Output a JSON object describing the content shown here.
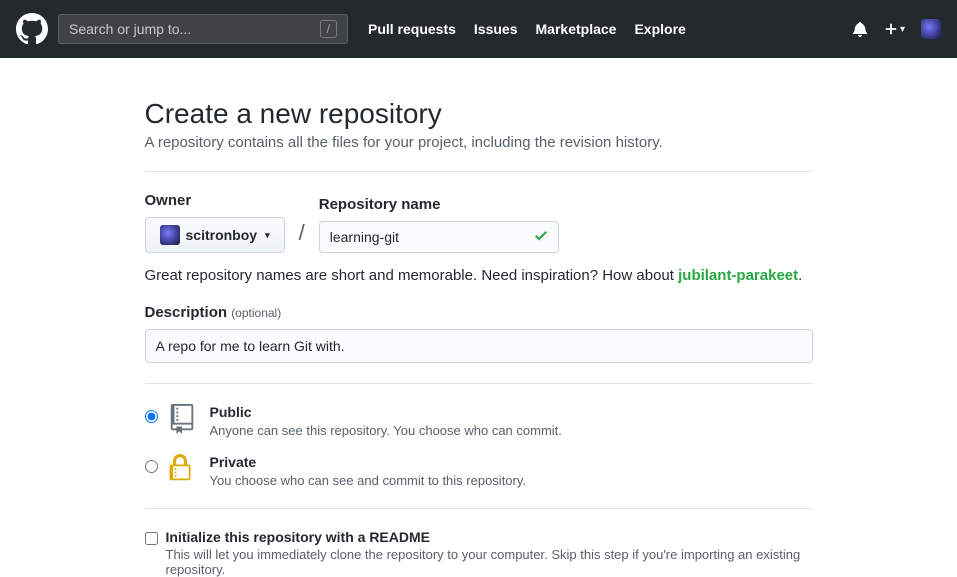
{
  "header": {
    "search_placeholder": "Search or jump to...",
    "slash_key": "/",
    "nav": {
      "pull_requests": "Pull requests",
      "issues": "Issues",
      "marketplace": "Marketplace",
      "explore": "Explore"
    }
  },
  "page": {
    "title": "Create a new repository",
    "subtitle": "A repository contains all the files for your project, including the revision history."
  },
  "form": {
    "owner_label": "Owner",
    "owner_value": "scitronboy",
    "slash": "/",
    "repo_label": "Repository name",
    "repo_value": "learning-git",
    "hint_prefix": "Great repository names are short and memorable. Need inspiration? How about ",
    "hint_suggestion": "jubilant-parakeet",
    "hint_suffix": ".",
    "desc_label": "Description",
    "desc_optional": "(optional)",
    "desc_value": "A repo for me to learn Git with.",
    "visibility": {
      "public": {
        "title": "Public",
        "note": "Anyone can see this repository. You choose who can commit."
      },
      "private": {
        "title": "Private",
        "note": "You choose who can see and commit to this repository."
      }
    },
    "init": {
      "title": "Initialize this repository with a README",
      "note": "This will let you immediately clone the repository to your computer. Skip this step if you're importing an existing repository."
    }
  }
}
